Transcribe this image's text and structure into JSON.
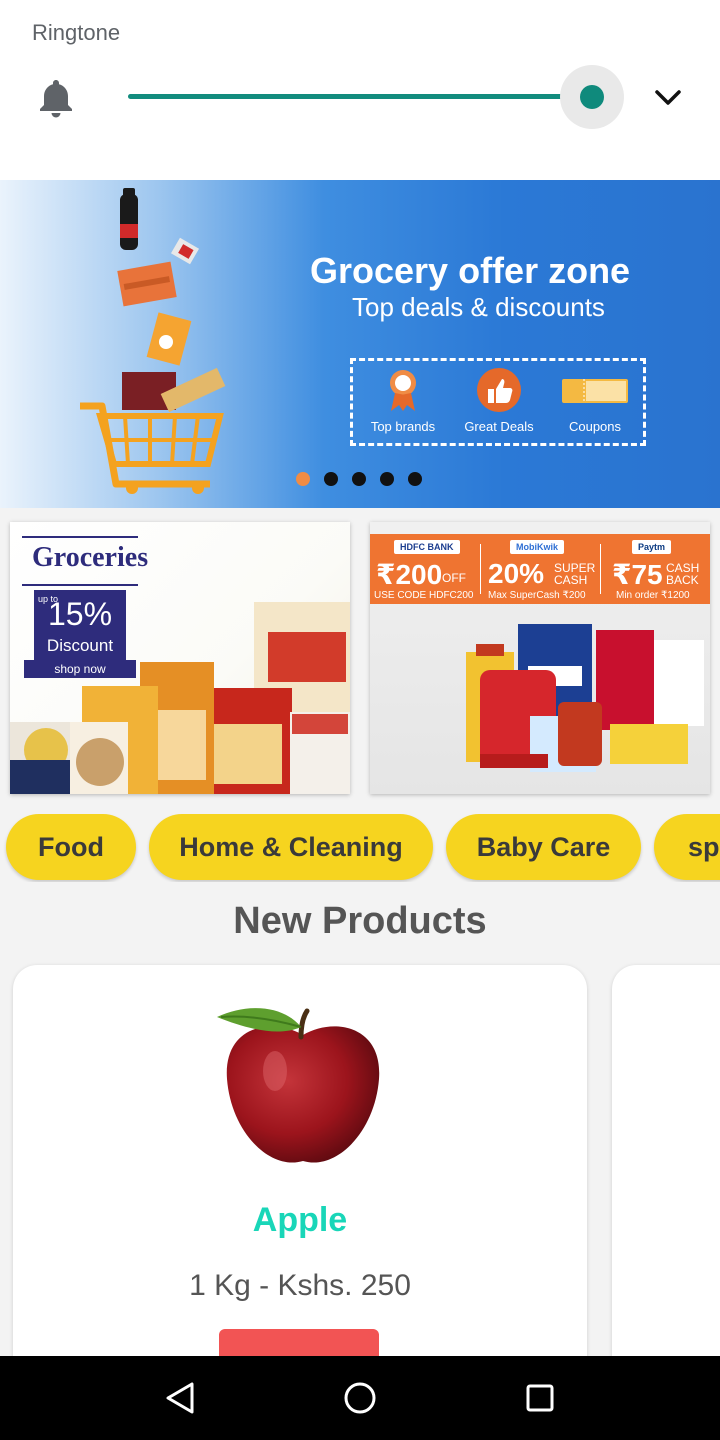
{
  "volume": {
    "label": "Ringtone",
    "level": 1.0,
    "icon": "bell-icon",
    "expand_icon": "chevron-down-icon",
    "accent": "#128c7e"
  },
  "hero": {
    "title": "Grocery offer zone",
    "subtitle": "Top deals & discounts",
    "features": [
      {
        "label": "Top brands",
        "icon": "badge-icon"
      },
      {
        "label": "Great Deals",
        "icon": "thumbs-up-icon"
      },
      {
        "label": "Coupons",
        "icon": "coupon-icon"
      }
    ],
    "carousel": {
      "count": 5,
      "active": 0
    }
  },
  "promos": {
    "groceries": {
      "title": "Groceries",
      "upto": "up to",
      "percent": "15%",
      "discount": "Discount",
      "cta": "shop now"
    },
    "offers": [
      {
        "tag": "HDFC BANK",
        "amount": "₹200",
        "suffix": "OFF",
        "note": "USE CODE HDFC200"
      },
      {
        "tag": "MobiKwik",
        "amount": "20%",
        "suffix": "SUPER CASH",
        "note": "Max SuperCash ₹200"
      },
      {
        "tag": "Paytm",
        "amount": "₹75",
        "suffix": "CASH BACK",
        "note": "Min order ₹1200"
      }
    ]
  },
  "categories": [
    {
      "label": "Food"
    },
    {
      "label": "Home & Cleaning"
    },
    {
      "label": "Baby Care"
    },
    {
      "label": "sp"
    }
  ],
  "section": {
    "title": "New Products"
  },
  "products": [
    {
      "name": "Apple",
      "price": "1 Kg - Kshs. 250",
      "image": "apple-image"
    }
  ],
  "navbar": {
    "back": "back-icon",
    "home": "home-icon",
    "recents": "recents-icon"
  },
  "colors": {
    "chip": "#f6d41f",
    "product_name": "#19d6b8",
    "add_button": "#f25454",
    "carousel_active": "#f08c45"
  }
}
